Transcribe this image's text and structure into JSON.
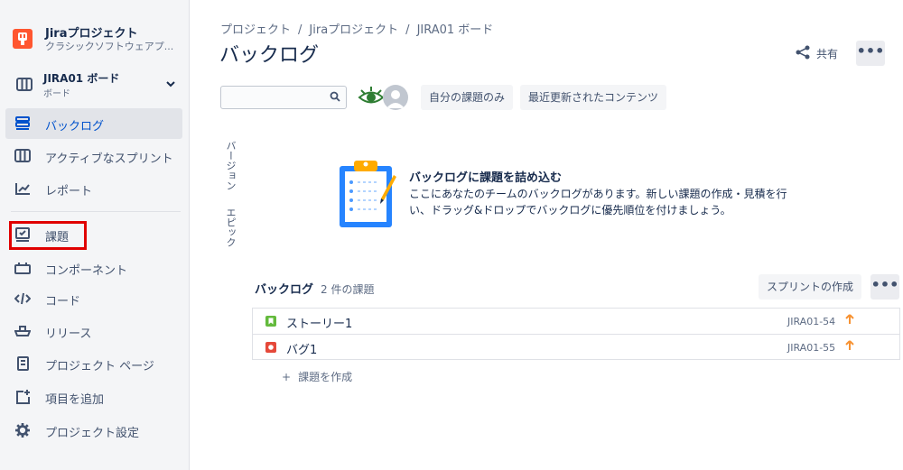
{
  "sidebar": {
    "project_name": "Jiraプロジェクト",
    "project_type": "クラシックソフトウェアプ...",
    "board_name": "JIRA01 ボード",
    "board_sub": "ボード",
    "items": [
      {
        "label": "バックログ",
        "icon": "backlog-icon"
      },
      {
        "label": "アクティブなスプリント",
        "icon": "board-columns-icon"
      },
      {
        "label": "レポート",
        "icon": "chart-line-icon"
      },
      {
        "label": "課題",
        "icon": "issues-icon"
      },
      {
        "label": "コンポーネント",
        "icon": "component-icon"
      },
      {
        "label": "コード",
        "icon": "code-icon"
      },
      {
        "label": "リリース",
        "icon": "ship-icon"
      },
      {
        "label": "プロジェクト ページ",
        "icon": "page-icon"
      },
      {
        "label": "項目を追加",
        "icon": "add-item-icon"
      },
      {
        "label": "プロジェクト設定",
        "icon": "gear-icon"
      }
    ]
  },
  "breadcrumb": {
    "items": [
      "プロジェクト",
      "Jiraプロジェクト",
      "JIRA01 ボード"
    ],
    "separator": "/"
  },
  "header": {
    "title": "バックログ",
    "share_label": "共有",
    "more_label": "•••"
  },
  "filters": {
    "search_value": "",
    "only_my_issues": "自分の課題のみ",
    "recently_updated": "最近更新されたコンテンツ"
  },
  "side_tabs": {
    "versions": "バージョン",
    "epics": "エピック"
  },
  "empty_state": {
    "title": "バックログに課題を詰め込む",
    "text": "ここにあなたのチームのバックログがあります。新しい課題の作成・見積を行い、ドラッグ&ドロップでバックログに優先順位を付けましょう。"
  },
  "backlog": {
    "title": "バックログ",
    "count": "2 件の課題",
    "create_sprint": "スプリントの作成",
    "more_label": "•••",
    "issues": [
      {
        "type": "story",
        "summary": "ストーリー1",
        "key": "JIRA01-54",
        "priority": "high"
      },
      {
        "type": "bug",
        "summary": "バグ1",
        "key": "JIRA01-55",
        "priority": "high"
      }
    ],
    "create_issue": "課題を作成",
    "create_issue_plus": "+"
  },
  "colors": {
    "accent": "#0052cc",
    "story": "#63ba3c",
    "bug": "#e5493a",
    "priority": "#f79232",
    "highlight_box": "#e00000"
  }
}
